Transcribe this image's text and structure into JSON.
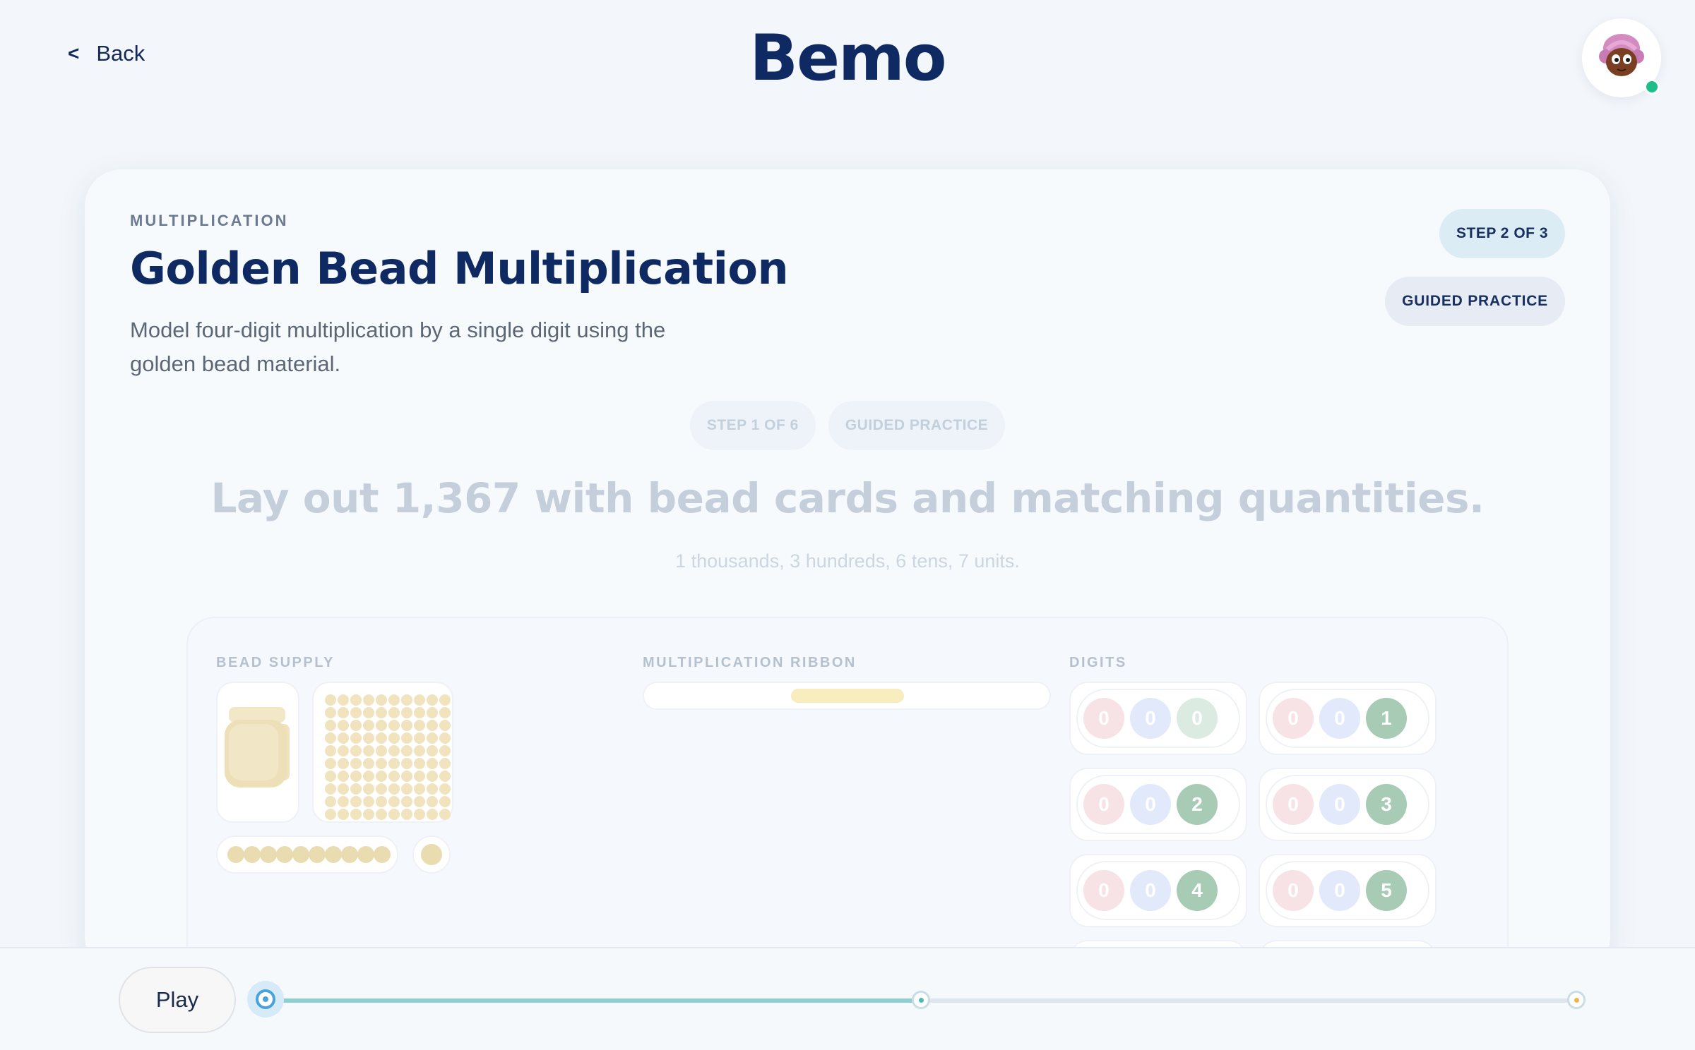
{
  "header": {
    "back_chevron": "<",
    "back_label": "Back",
    "logo": "Bemo",
    "avatar_icon": "cartoon-girl-avatar",
    "status": "online"
  },
  "lesson": {
    "eyebrow": "MULTIPLICATION",
    "title": "Golden Bead Multiplication",
    "subtitle": "Model four-digit multiplication by a single digit using the golden bead material.",
    "step_badge": "STEP 2 OF 3",
    "mode_badge": "GUIDED PRACTICE"
  },
  "activity": {
    "step_badge": "STEP 1 OF 6",
    "mode_badge": "GUIDED PRACTICE",
    "prompt": "Lay out 1,367 with bead cards and matching quantities.",
    "hint": "1 thousands, 3 hundreds, 6 tens, 7 units.",
    "sections": {
      "bead_supply": "BEAD SUPPLY",
      "ribbon": "MULTIPLICATION RIBBON",
      "digits": "DIGITS"
    },
    "digit_cards": [
      {
        "thousands": "0",
        "hundreds": "0",
        "units": "0"
      },
      {
        "thousands": "0",
        "hundreds": "0",
        "units": "1"
      },
      {
        "thousands": "0",
        "hundreds": "0",
        "units": "2"
      },
      {
        "thousands": "0",
        "hundreds": "0",
        "units": "3"
      },
      {
        "thousands": "0",
        "hundreds": "0",
        "units": "4"
      },
      {
        "thousands": "0",
        "hundreds": "0",
        "units": "5"
      }
    ]
  },
  "player": {
    "play_label": "Play",
    "progress_fraction": 0.5
  },
  "colors": {
    "brand": "#0f2a63",
    "online": "#1cbf8a",
    "progress": "#8ecfd4",
    "knob": "#4aa3d8"
  }
}
